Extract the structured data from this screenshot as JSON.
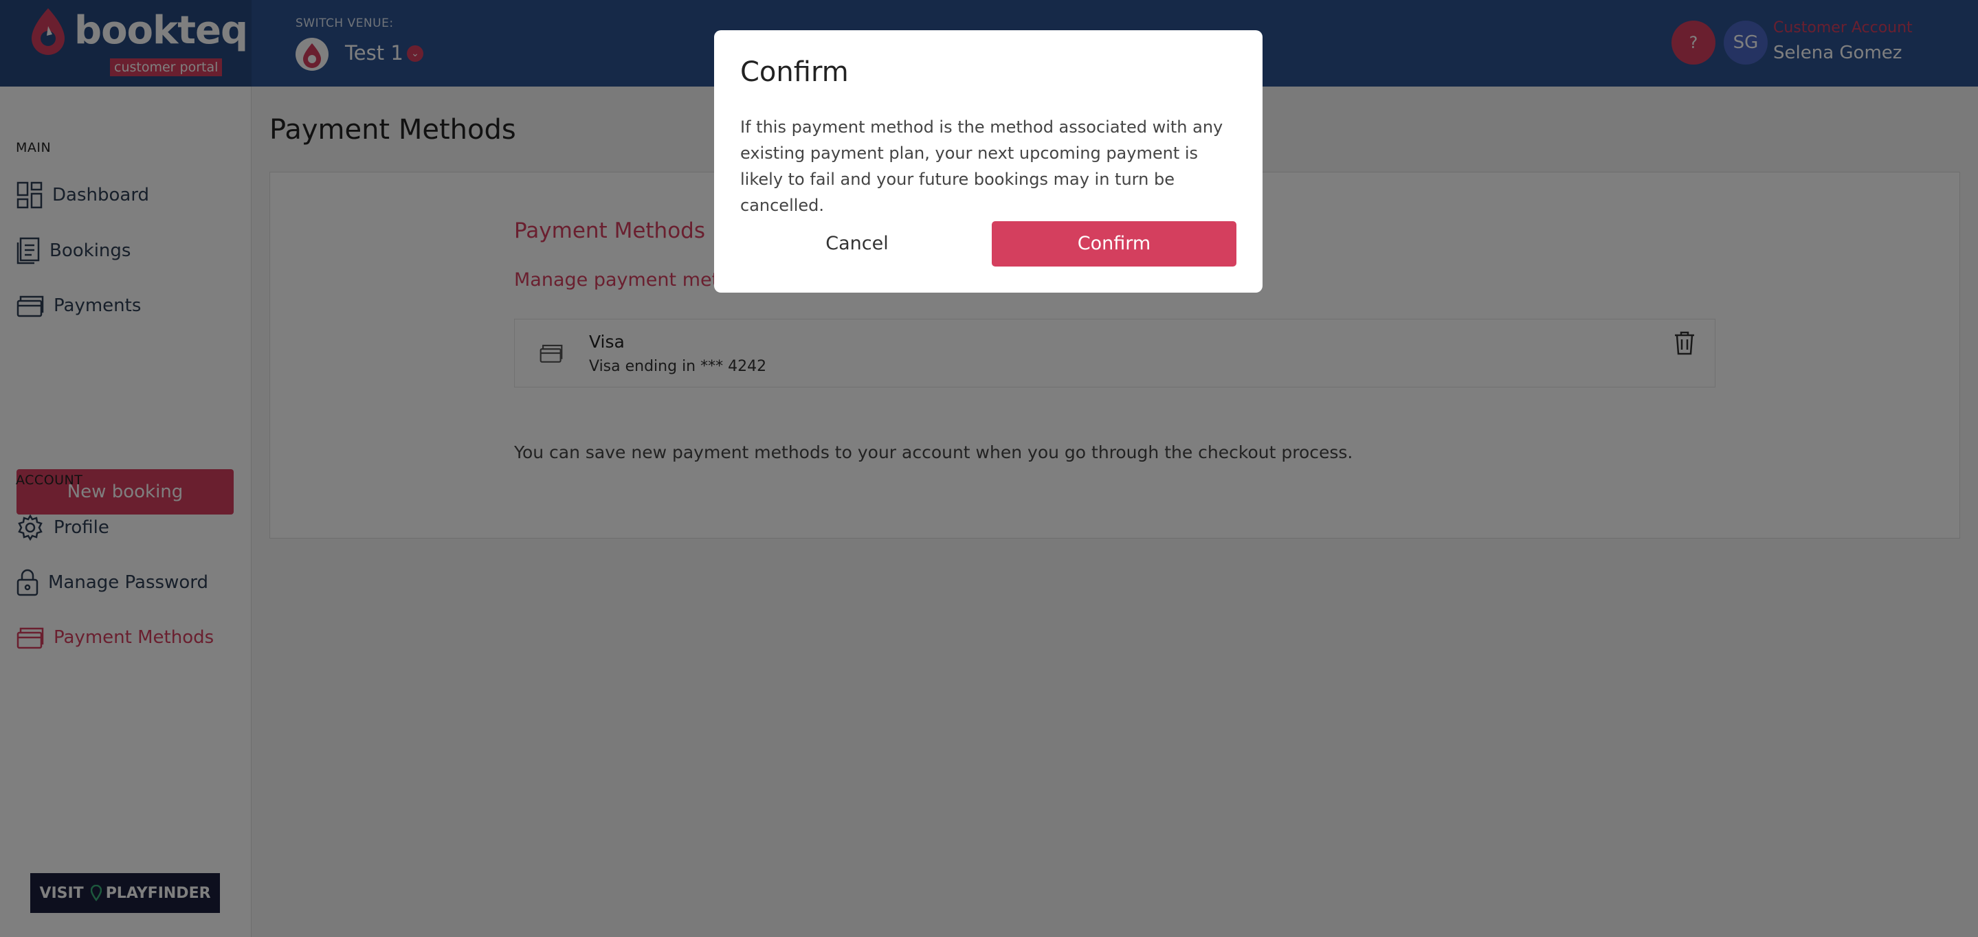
{
  "brand": {
    "name": "bookteq",
    "subtitle": "customer portal",
    "accent_color": "#d43f5e",
    "header_color": "#2c5391"
  },
  "header": {
    "switch_venue_label": "SWITCH VENUE:",
    "venue_name": "Test 1",
    "help_label": "?",
    "avatar_initials": "SG",
    "account_type": "Customer Account",
    "account_name": "Selena Gomez"
  },
  "sidebar": {
    "main_label": "MAIN",
    "main_items": [
      {
        "label": "Dashboard",
        "icon": "dashboard-icon"
      },
      {
        "label": "Bookings",
        "icon": "bookings-icon"
      },
      {
        "label": "Payments",
        "icon": "payments-icon"
      }
    ],
    "new_booking_label": "New booking",
    "account_label": "ACCOUNT",
    "account_items": [
      {
        "label": "Profile",
        "icon": "gear-icon"
      },
      {
        "label": "Manage Password",
        "icon": "lock-icon"
      },
      {
        "label": "Payment Methods",
        "icon": "card-icon",
        "active": true
      }
    ],
    "playfinder": {
      "prefix": "VISIT",
      "name": "PLAYFINDER"
    }
  },
  "main": {
    "page_title": "Payment Methods",
    "card_title": "Payment Methods",
    "card_subtitle": "Manage payment methods",
    "payment_methods": [
      {
        "name": "Visa",
        "description": "Visa ending in *** 4242"
      }
    ],
    "note": "You can save new payment methods to your account when you go through the checkout process."
  },
  "modal": {
    "title": "Confirm",
    "body": "If this payment method is the method associated with any existing payment plan, your next upcoming payment is likely to fail and your future bookings may in turn be cancelled.",
    "cancel_label": "Cancel",
    "confirm_label": "Confirm"
  }
}
